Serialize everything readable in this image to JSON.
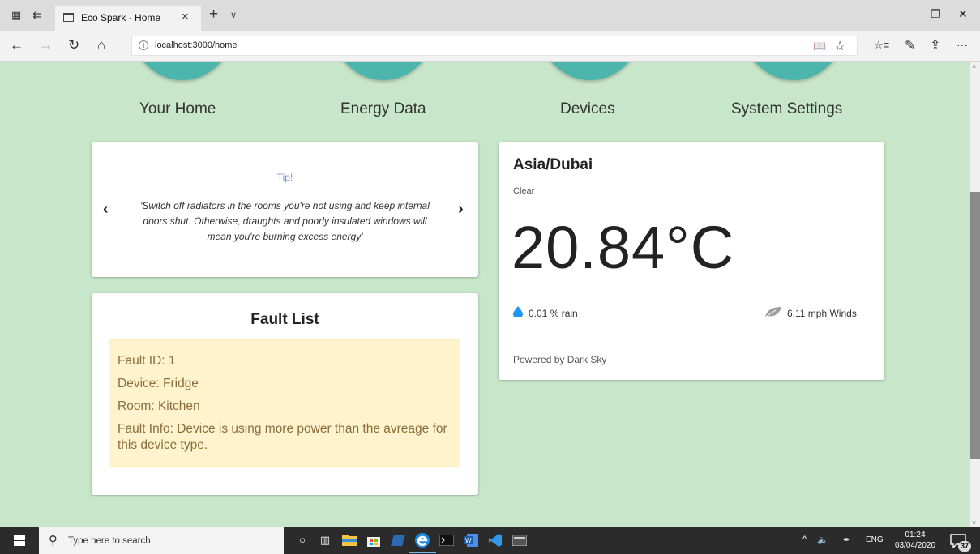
{
  "browser": {
    "tab_title": "Eco Spark - Home",
    "tab_close": "×",
    "new_tab": "+",
    "tab_list": "∨",
    "url": "localhost:3000/home",
    "info": "i",
    "minimize": "–",
    "restore": "❐",
    "close": "✕",
    "back": "←",
    "forward": "→",
    "refresh": "↻",
    "home": "⌂",
    "reading_view": "📖",
    "favorite": "☆",
    "favorites_hub": "☆≡",
    "notes": "✎",
    "share": "⇪",
    "more": "···"
  },
  "nav": {
    "items": [
      {
        "label": "Your Home"
      },
      {
        "label": "Energy Data"
      },
      {
        "label": "Devices"
      },
      {
        "label": "System Settings"
      }
    ]
  },
  "tip": {
    "title": "Tip!",
    "text": "'Switch off radiators in the rooms you're not using and keep internal doors shut. Otherwise, draughts and poorly insulated windows will mean you're burning excess energy'",
    "prev": "‹",
    "next": "›"
  },
  "fault": {
    "title": "Fault List",
    "id": "Fault ID: 1",
    "device": "Device: Fridge",
    "room": "Room: Kitchen",
    "info": "Fault Info: Device is using more power than the avreage for this device type."
  },
  "weather": {
    "city": "Asia/Dubai",
    "summary": "Clear",
    "temperature": "20.84°C",
    "rain": "0.01 % rain",
    "wind": "6.11 mph Winds",
    "powered_by": "Powered by Dark Sky",
    "colors": {
      "rain_icon": "#2196f3",
      "wind_icon": "#9e9e9e"
    }
  },
  "taskbar": {
    "search_placeholder": "Type here to search",
    "tray_chevron": "^",
    "volume": "🔈",
    "pen": "✒",
    "language": "ENG",
    "time": "01:24",
    "date": "03/04/2020",
    "notification_count": "37"
  },
  "colors": {
    "page_bg": "#c8e6c9",
    "circle": "#4db6ac",
    "tip_title": "#7b96d8",
    "fault_bg": "#fff3cd",
    "fault_text": "#8a6d3b"
  }
}
